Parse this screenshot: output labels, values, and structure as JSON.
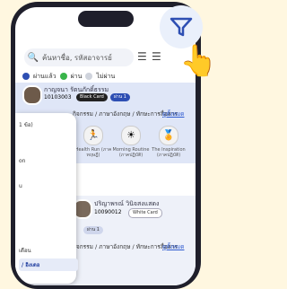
{
  "header": {
    "search_placeholder": "ค้นหาชื่อ, รหัสอาจารย์",
    "legend": [
      "ผ่านแล้ว",
      "ผ่าน",
      "ไม่ผ่าน"
    ]
  },
  "card1": {
    "rank": "1",
    "name": "กาญจนา รัตนภักดิ์ธรรม",
    "id": "10103003",
    "card_type": "Black Card",
    "status_text": "ผ่าน 1",
    "task": "กิจกรรม / ภาษาอังกฤษ / ทักษะการสื่อสาร",
    "link": "ดูทั้งหมด",
    "badges": [
      {
        "icon": "running-icon",
        "label": "Health Run (ภาคทฤษฎี)"
      },
      {
        "icon": "sun-icon",
        "label": "Morning Routine (ภาคปฏิบัติ)"
      },
      {
        "icon": "medal-icon",
        "label": "The Inspiration (ภาคปฏิบัติ)"
      }
    ]
  },
  "card2": {
    "name": "ปริญาพรณ์ วินิจสงแสดง",
    "id": "10090012",
    "card_type": "White Card",
    "status_text": "ผ่าน 1",
    "task": "กิจกรรม / ภาษาอังกฤษ / ทักษะการสื่อสาร",
    "link": "ดูทั้งหมด"
  },
  "panel": {
    "options": [
      "1 ข้อ)",
      "on",
      "u",
      "เดือน",
      "/ อิงเดอ"
    ]
  },
  "colors": {
    "primary": "#2e4fb3",
    "phone": "#1f1f2b",
    "bg": "#fff7e0"
  }
}
